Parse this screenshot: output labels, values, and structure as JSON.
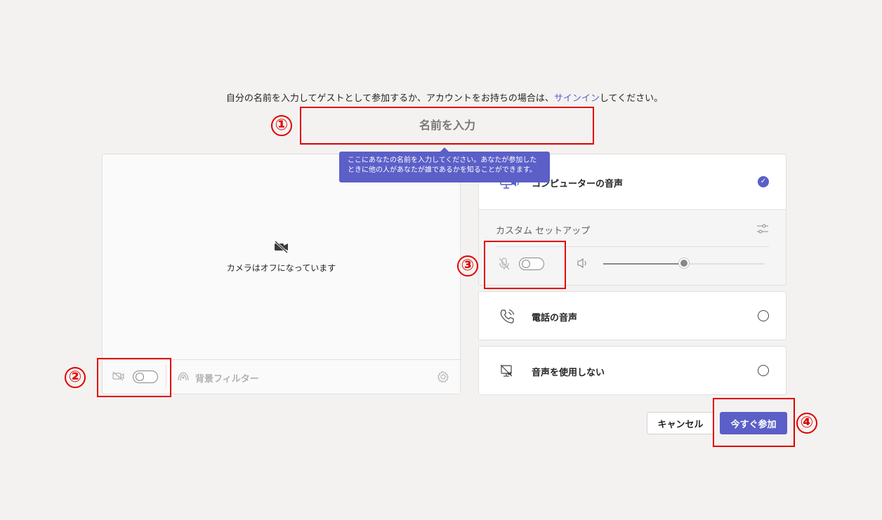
{
  "instruction": {
    "prefix": "自分の名前を入力してゲストとして参加するか、アカウントをお持ちの場合は、",
    "signin_link": "サインイン",
    "suffix": "してください。"
  },
  "name_input": {
    "placeholder": "名前を入力",
    "value": ""
  },
  "tooltip": {
    "text": "ここにあなたの名前を入力してください。あなたが参加したときに他の人があなたが誰であるかを知ることができます。"
  },
  "video": {
    "camera_off_text": "カメラはオフになっています",
    "camera_toggle": false,
    "background_filter_label": "背景フィルター"
  },
  "audio": {
    "computer_audio_label": "コンピューターの音声",
    "computer_audio_selected": true,
    "custom_setup_label": "カスタム セットアップ",
    "mic_toggle": false,
    "speaker_volume_fraction": 0.5,
    "phone_audio_label": "電話の音声",
    "no_audio_label": "音声を使用しない"
  },
  "buttons": {
    "cancel": "キャンセル",
    "join_now": "今すぐ参加"
  },
  "annotations": [
    "①",
    "②",
    "③",
    "④"
  ],
  "colors": {
    "accent": "#5b5fc7",
    "annotation_red": "#e00000",
    "background": "#f3f2f1"
  }
}
